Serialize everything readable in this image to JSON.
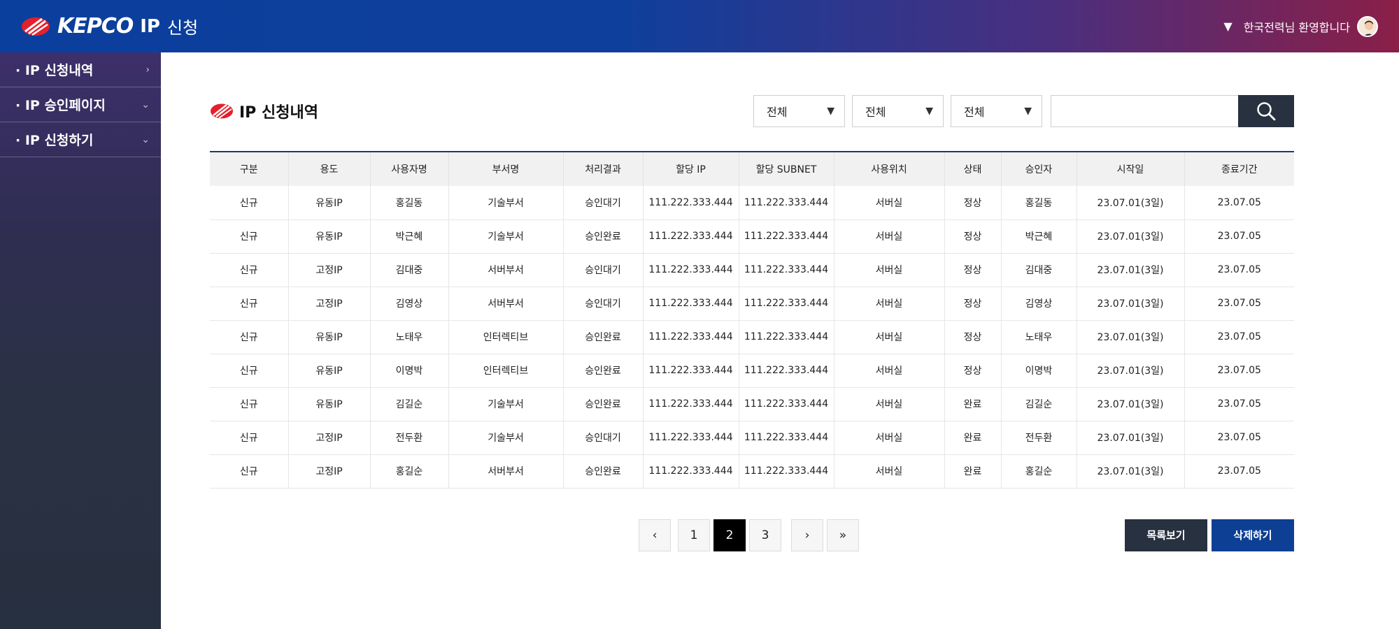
{
  "header": {
    "brand_name": "KEPCO",
    "brand_ip": "IP",
    "brand_sub": "신청",
    "user_greeting": "한국전력님 환영합니다"
  },
  "sidebar": {
    "items": [
      {
        "label": "· IP 신청내역"
      },
      {
        "label": "· IP 승인페이지"
      },
      {
        "label": "· IP 신청하기"
      }
    ]
  },
  "page": {
    "title": "IP 신청내역"
  },
  "filters": [
    {
      "value": "전체"
    },
    {
      "value": "전체"
    },
    {
      "value": "전체"
    }
  ],
  "search": {
    "placeholder": ""
  },
  "table": {
    "columns": [
      "구분",
      "용도",
      "사용자명",
      "부서명",
      "처리결과",
      "할당 IP",
      "할당 SUBNET",
      "사용위치",
      "상태",
      "승인자",
      "시작일",
      "종료기간"
    ],
    "rows": [
      [
        "신규",
        "유동IP",
        "홍길동",
        "기술부서",
        "승인대기",
        "111.222.333.444",
        "111.222.333.444",
        "서버실",
        "정상",
        "홍길동",
        "23.07.01(3일)",
        "23.07.05"
      ],
      [
        "신규",
        "유동IP",
        "박근혜",
        "기술부서",
        "승인완료",
        "111.222.333.444",
        "111.222.333.444",
        "서버실",
        "정상",
        "박근혜",
        "23.07.01(3일)",
        "23.07.05"
      ],
      [
        "신규",
        "고정IP",
        "김대중",
        "서버부서",
        "승인대기",
        "111.222.333.444",
        "111.222.333.444",
        "서버실",
        "정상",
        "김대중",
        "23.07.01(3일)",
        "23.07.05"
      ],
      [
        "신규",
        "고정IP",
        "김영상",
        "서버부서",
        "승인대기",
        "111.222.333.444",
        "111.222.333.444",
        "서버실",
        "정상",
        "김영상",
        "23.07.01(3일)",
        "23.07.05"
      ],
      [
        "신규",
        "유동IP",
        "노태우",
        "인터렉티브",
        "승인완료",
        "111.222.333.444",
        "111.222.333.444",
        "서버실",
        "정상",
        "노태우",
        "23.07.01(3일)",
        "23.07.05"
      ],
      [
        "신규",
        "유동IP",
        "이명박",
        "인터렉티브",
        "승인완료",
        "111.222.333.444",
        "111.222.333.444",
        "서버실",
        "정상",
        "이명박",
        "23.07.01(3일)",
        "23.07.05"
      ],
      [
        "신규",
        "유동IP",
        "김길순",
        "기술부서",
        "승인완료",
        "111.222.333.444",
        "111.222.333.444",
        "서버실",
        "완료",
        "김길순",
        "23.07.01(3일)",
        "23.07.05"
      ],
      [
        "신규",
        "고정IP",
        "전두환",
        "기술부서",
        "승인대기",
        "111.222.333.444",
        "111.222.333.444",
        "서버실",
        "완료",
        "전두환",
        "23.07.01(3일)",
        "23.07.05"
      ],
      [
        "신규",
        "고정IP",
        "홍길순",
        "서버부서",
        "승인완료",
        "111.222.333.444",
        "111.222.333.444",
        "서버실",
        "완료",
        "홍길순",
        "23.07.01(3일)",
        "23.07.05"
      ]
    ]
  },
  "pagination": {
    "pages": [
      "1",
      "2",
      "3"
    ],
    "current": "2"
  },
  "actions": {
    "list_label": "목록보기",
    "delete_label": "삭제하기"
  },
  "colors": {
    "header_start": "#0b3f9d",
    "header_end": "#8a1f48",
    "dark_button": "#27313f",
    "blue_button": "#0d3f94",
    "table_top_border": "#1b3a6b"
  }
}
